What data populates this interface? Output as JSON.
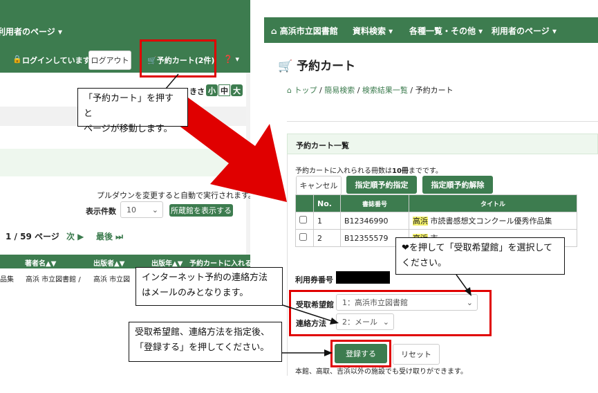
{
  "left_panel": {
    "nav_user_page": "利用者のページ ▾",
    "logged_in": "ログインしています",
    "logout_button": "ログアウト",
    "cart_button": "予約カート(2件)",
    "help_icon_label": "❓ ▾",
    "font_size_tail": "きさ",
    "font_sizes": [
      "小",
      "中",
      "大"
    ],
    "pulldown_note": "プルダウンを変更すると自動で実行されます。",
    "display_count_label": "表示件数",
    "display_count_value": "10",
    "show_holdings_button": "所蔵館を表示する",
    "pagination_current": "1 / 59 ページ",
    "pagination_next": "次 ▶",
    "pagination_last": "最後 ⏭",
    "columns": [
      "著者名▲▼",
      "出版者▲▼",
      "出版年▲▼",
      "予約カートに入れる"
    ],
    "row_fragment_a": "品集",
    "row_author": "高浜 市立図書館 /",
    "row_publisher": "高浜 市立図"
  },
  "right_panel": {
    "nav_home": "高浜市立図書館",
    "nav_search": "資料検索 ▾",
    "nav_lists": "各種一覧・その他 ▾",
    "nav_user": "利用者のページ ▾",
    "page_title": "予約カート",
    "breadcrumb": [
      "トップ",
      "簡易検索",
      "検索結果一覧",
      "予約カート"
    ],
    "breadcrumb_sep": "/",
    "section_title": "予約カート一覧",
    "limit_prefix": "予約カートに入れられる冊数は",
    "limit_value": "10冊",
    "limit_suffix": "までです。",
    "cancel_button": "キャンセル",
    "order_reserve_button": "指定順予約指定",
    "order_cancel_button": "指定順予約解除",
    "table_headers": [
      "No.",
      "書誌番号",
      "タイトル"
    ],
    "rows": [
      {
        "no": "1",
        "id": "B12346990",
        "hl": "高浜",
        "title": "市読書感想文コンクール優秀作品集"
      },
      {
        "no": "2",
        "id": "B12355579",
        "hl": "高浜",
        "title": "市..."
      }
    ],
    "card_label": "利用券番号",
    "pickup_label": "受取希望館",
    "pickup_value": "1：高浜市立図書館",
    "contact_label": "連絡方法",
    "contact_value": "2：メール",
    "register_button": "登録する",
    "reset_button": "リセット",
    "footer_note": "本館、高取、吉浜以外の施設でも受け取りができます。"
  },
  "callouts": {
    "cart_note_1": "「予約カート」を押すと",
    "cart_note_2": "ページが移動します。",
    "pickup_note_1": "❤を押して「受取希望館」を選択して",
    "pickup_note_2": "ください。",
    "contact_note_1": "インターネット予約の連絡方法",
    "contact_note_2": "はメールのみとなります。",
    "register_note_1": "受取希望館、連絡方法を指定後、",
    "register_note_2": "「登録する」を押してください。"
  },
  "colors": {
    "header_green": "#3d7c4f",
    "highlight_red": "#e00000",
    "highlight_yellow": "#f2ef6a",
    "panel_green_tint": "#eef7ee"
  }
}
